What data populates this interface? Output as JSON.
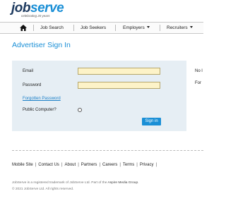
{
  "logo": {
    "brand_job": "job",
    "brand_serve": "serve",
    "tagline": "celebrating 20 years"
  },
  "nav": {
    "items": [
      {
        "label": "Job Search"
      },
      {
        "label": "Job Seekers"
      },
      {
        "label": "Employers"
      },
      {
        "label": "Recruiters"
      }
    ]
  },
  "page": {
    "title": "Advertiser Sign In"
  },
  "form": {
    "email_label": "Email",
    "email_value": "",
    "password_label": "Password",
    "password_value": "",
    "forgotten_link": "Forgotten Password",
    "public_computer_label": "Public Computer?",
    "signin_label": "Sign in"
  },
  "side": {
    "line1": "No l",
    "line2": "For"
  },
  "footer": {
    "links": [
      "Mobile Site",
      "Contact Us",
      "About",
      "Partners",
      "Careers",
      "Terms",
      "Privacy"
    ],
    "legal_line1_pre": "JobServe is a registered trademark of JobServe Ltd. Part of the ",
    "legal_group": "Aspire Media Group",
    "legal_line1_post": ".",
    "legal_line2": "© 2021 JobServe Ltd. All rights reserved."
  },
  "colors": {
    "brand_blue": "#1a8fd6",
    "brand_navy": "#1d3a5f",
    "input_fill": "#fdf3c8",
    "form_bg": "#e6eef4"
  }
}
